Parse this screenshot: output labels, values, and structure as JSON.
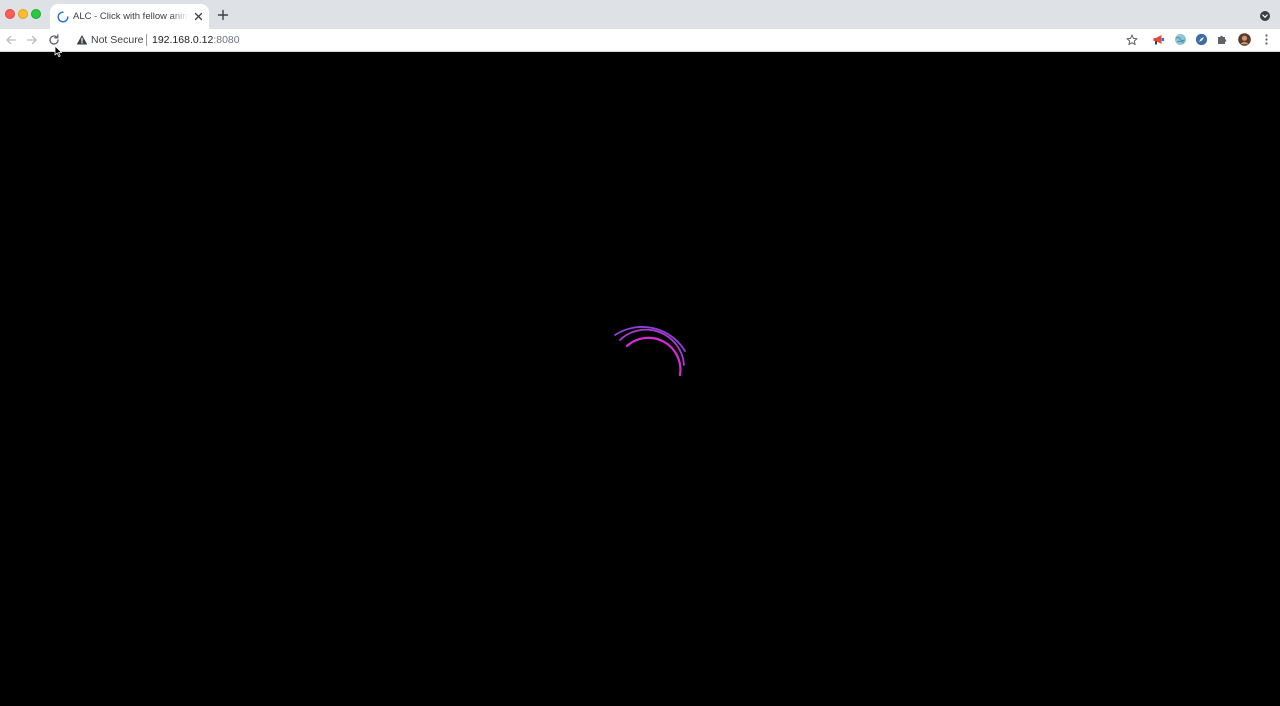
{
  "browser": {
    "tab": {
      "title": "ALC - Click with fellow animal lovers",
      "loading": true
    },
    "address_bar": {
      "security_label": "Not Secure",
      "host": "192.168.0.12",
      "port": ":8080"
    },
    "extensions": [
      "megaphone-icon",
      "globe-icon",
      "compass-icon",
      "puzzle-icon"
    ]
  },
  "page": {
    "background": "#000000",
    "loader_colors": [
      "#8f3fd1",
      "#d42bd6"
    ]
  }
}
